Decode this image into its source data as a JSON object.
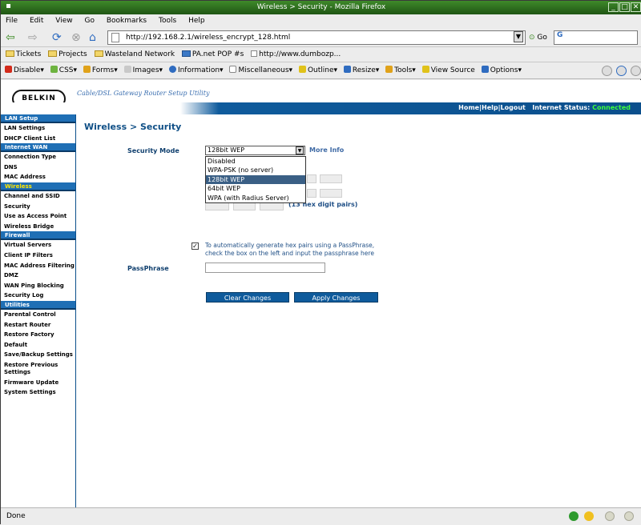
{
  "window": {
    "title": "Wireless > Security - Mozilla Firefox"
  },
  "menu": [
    "File",
    "Edit",
    "View",
    "Go",
    "Bookmarks",
    "Tools",
    "Help"
  ],
  "nav": {
    "url": "http://192.168.2.1/wireless_encrypt_128.html",
    "go_label": "Go",
    "search_value": "G"
  },
  "bookmarks": [
    "Tickets",
    "Projects",
    "Wasteland Network",
    "PA.net POP #s",
    "http://www.dumbozp..."
  ],
  "devbar": [
    "Disable▾",
    "CSS▾",
    "Forms▾",
    "Images▾",
    "Information▾",
    "Miscellaneous▾",
    "Outline▾",
    "Resize▾",
    "Tools▾",
    "View Source",
    "Options▾"
  ],
  "header": {
    "logo": "BELKIN",
    "tagline": "Cable/DSL Gateway Router Setup Utility",
    "link_home": "Home",
    "link_help": "Help",
    "link_logout": "Logout",
    "status_label": "Internet Status:",
    "status_value": "Connected"
  },
  "sidebar": {
    "lan_head": "LAN Setup",
    "lan": [
      "LAN Settings",
      "DHCP Client List"
    ],
    "wan_head": "Internet WAN",
    "wan": [
      "Connection Type",
      "DNS",
      "MAC Address"
    ],
    "wireless_head": "Wireless",
    "wireless": [
      "Channel and SSID",
      "Security",
      "Use as Access Point",
      "Wireless Bridge"
    ],
    "firewall_head": "Firewall",
    "firewall": [
      "Virtual Servers",
      "Client IP Filters",
      "MAC Address Filtering",
      "DMZ",
      "WAN Ping Blocking",
      "Security Log"
    ],
    "utilities_head": "Utilities",
    "utilities": [
      "Parental Control",
      "Restart Router",
      "Restore Factory Default",
      "Save/Backup Settings",
      "Restore Previous Settings",
      "Firmware Update",
      "System Settings"
    ]
  },
  "main": {
    "title": "Wireless > Security",
    "security_mode_label": "Security Mode",
    "security_mode_value": "128bit WEP",
    "more_info": "More Info",
    "options": [
      "Disabled",
      "WPA-PSK (no server)",
      "128bit WEP",
      "64bit WEP",
      "WPA (with Radius Server)"
    ],
    "hex_note": "(13 hex digit pairs)",
    "checkbox_mark": "✓",
    "checkbox_text": "To automatically generate hex pairs using a PassPhrase, check the box on the left and input the passphrase here",
    "passphrase_label": "PassPhrase",
    "clear_button": "Clear Changes",
    "apply_button": "Apply Changes"
  },
  "status": {
    "text": "Done"
  }
}
